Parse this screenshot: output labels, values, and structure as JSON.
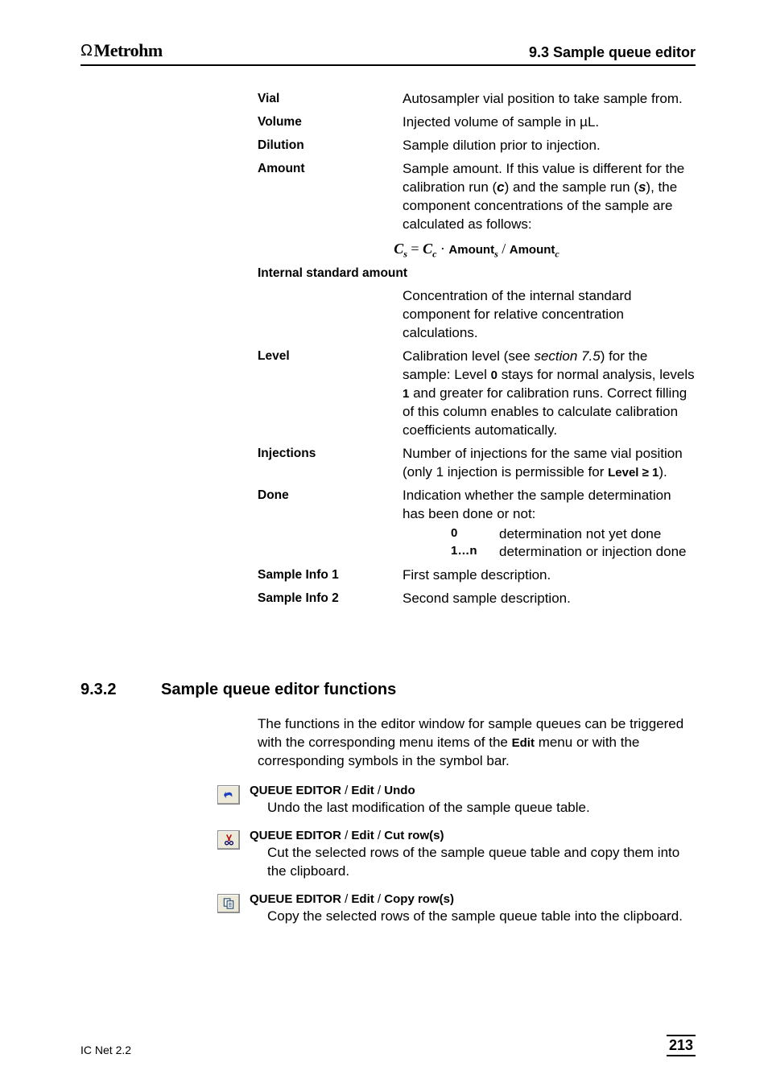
{
  "header": {
    "brand": "Metrohm",
    "section": "9.3  Sample queue editor"
  },
  "definitions": {
    "vial": {
      "term": "Vial",
      "desc": "Autosampler vial position to take sample from."
    },
    "volume": {
      "term": "Volume",
      "desc": "Injected volume of sample in µL."
    },
    "dilution": {
      "term": "Dilution",
      "desc": "Sample dilution prior to injection."
    },
    "amount": {
      "term": "Amount",
      "desc_pre": "Sample amount. If this value is different for the calibration run (",
      "desc_c": "c",
      "desc_mid": ") and the sample run (",
      "desc_s": "s",
      "desc_post": "), the component concentrations of the sample are calculated as follows:"
    },
    "formula": {
      "cs": "C",
      "sub_s": "s",
      "eq": " = ",
      "cc": "C",
      "sub_c": "c",
      "dot": " · ",
      "amt": "Amount",
      "slash": " / "
    },
    "internal_std": {
      "term": "Internal standard amount",
      "desc": "Concentration of the internal standard component for relative concentration calculations."
    },
    "level": {
      "term": "Level",
      "d1": "Calibration level (see ",
      "d2": "section 7.5",
      "d3": ") for the sample: Level ",
      "d4": "0",
      "d5": " stays for normal analysis, levels ",
      "d6": "1",
      "d7": " and greater for calibration runs. Correct filling of this column enables to calculate calibration coefficients automatically."
    },
    "injections": {
      "term": "Injections",
      "d1": "Number of injections for the same vial position (only 1 injection is permissible for ",
      "d2": "Level ≥ 1",
      "d3": ")."
    },
    "done": {
      "term": "Done",
      "desc": "Indication whether the sample determination has been done or not:",
      "k0": "0",
      "v0": "determination not yet done",
      "k1": "1…n",
      "v1": "determination or injection done"
    },
    "sample1": {
      "term": "Sample Info 1",
      "desc": "First sample description."
    },
    "sample2": {
      "term": "Sample Info 2",
      "desc": "Second sample description."
    }
  },
  "section932": {
    "num": "9.3.2",
    "title": "Sample queue editor functions",
    "intro_a": "The functions in the editor window for sample queues can be triggered with the corresponding menu items of the ",
    "intro_b": "Edit",
    "intro_c": " menu or with the corresponding symbols in the symbol bar."
  },
  "funcs": {
    "undo": {
      "path_a": "QUEUE EDITOR",
      "path_b": "Edit",
      "path_c": "Undo",
      "desc": "Undo the last modification of the sample queue table."
    },
    "cut": {
      "path_a": "QUEUE EDITOR",
      "path_b": "Edit",
      "path_c": "Cut row(s)",
      "desc": "Cut the selected rows of the sample queue table and copy them into the clipboard."
    },
    "copy": {
      "path_a": "QUEUE EDITOR",
      "path_b": "Edit",
      "path_c": "Copy row(s)",
      "desc": "Copy the selected rows of the sample queue table into the clipboard."
    }
  },
  "footer": {
    "left": "IC Net 2.2",
    "page": "213"
  }
}
